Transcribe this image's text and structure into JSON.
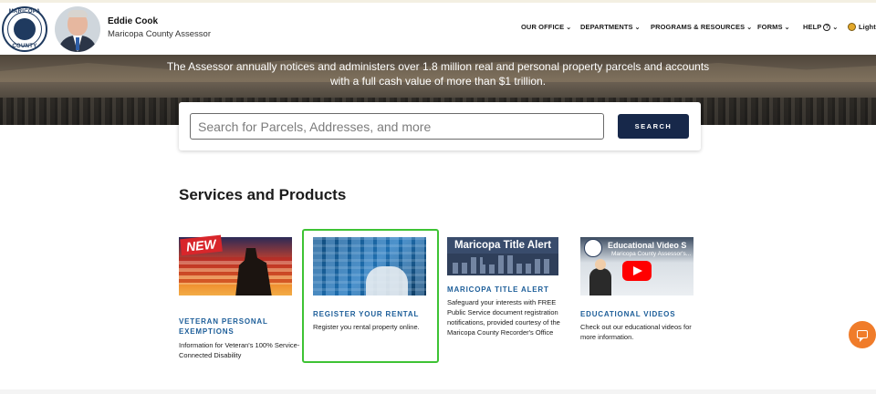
{
  "header": {
    "seal_text_top": "MARICOPA",
    "seal_text_bottom": "COUNTY",
    "person_name": "Eddie Cook",
    "person_title": "Maricopa County Assessor"
  },
  "nav": {
    "items": [
      {
        "label": "OUR OFFICE"
      },
      {
        "label": "DEPARTMENTS"
      },
      {
        "label": "PROGRAMS & RESOURCES"
      },
      {
        "label": "FORMS"
      },
      {
        "label": "HELP"
      },
      {
        "label": "Light"
      }
    ],
    "chevron": "⌄"
  },
  "hero": {
    "text": "The Assessor annually notices and administers over 1.8 million real and personal property parcels and accounts with a full cash value of more than $1 trillion."
  },
  "search": {
    "placeholder": "Search for Parcels, Addresses, and more",
    "value": "",
    "button_label": "SEARCH"
  },
  "services": {
    "title": "Services and Products",
    "cards": [
      {
        "thumb_badge": "NEW",
        "title": "VETERAN PERSONAL EXEMPTIONS",
        "description": "Information for Veteran's 100% Service-Connected Disability"
      },
      {
        "title": "REGISTER YOUR RENTAL",
        "description": "Register you rental property online."
      },
      {
        "thumb_heading": "Maricopa Title Alert",
        "title": "MARICOPA TITLE ALERT",
        "description": "Safeguard your interests with FREE Public Service document registration notifications, provided courtesy of the Maricopa County Recorder's Office"
      },
      {
        "thumb_heading": "Educational Video S",
        "thumb_sub": "Maricopa County Assessor's...",
        "title": "EDUCATIONAL VIDEOS",
        "description": "Check out our educational videos for more information."
      }
    ]
  },
  "colors": {
    "accent_blue": "#1d5e99",
    "search_button": "#17284a",
    "highlight_border": "#3ec334",
    "chat_button": "#f07c2a"
  },
  "icons": {
    "seal": "county-seal-icon",
    "help": "question-circle-icon",
    "theme": "sun-icon",
    "chat": "chat-icon"
  }
}
